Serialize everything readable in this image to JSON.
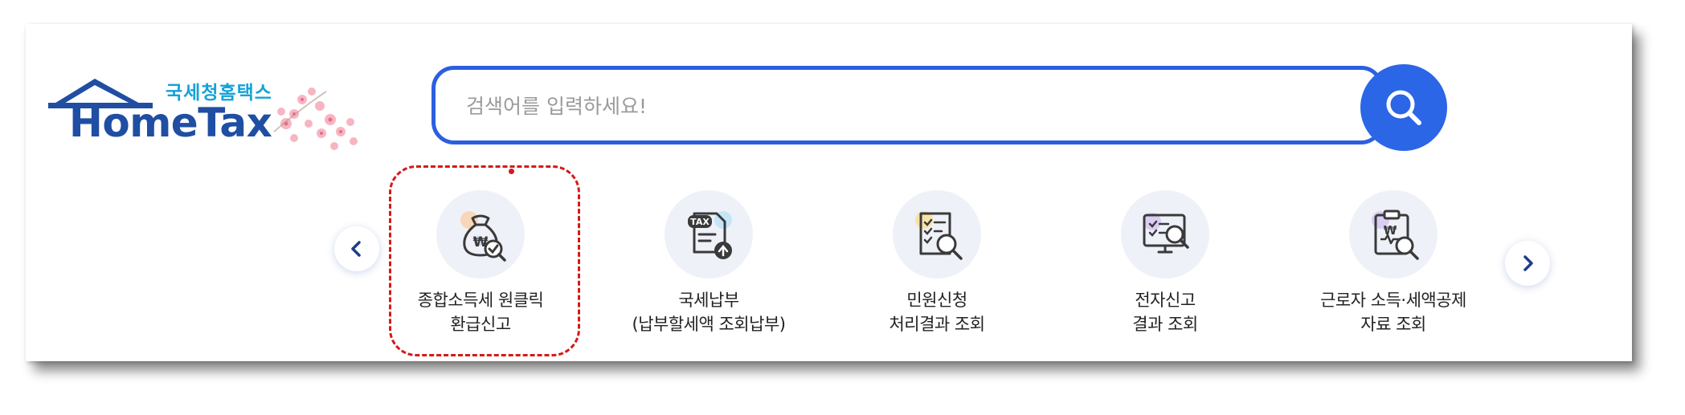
{
  "logo": {
    "subtitle": "국세청홈택스",
    "title": "HomeTax",
    "colors": {
      "title": "#1f4ea3",
      "subtitle": "#14a2d8"
    }
  },
  "search": {
    "placeholder": "검색어를 입력하세요!",
    "value": "",
    "accent_color": "#2c5fe0",
    "button_icon": "search-icon"
  },
  "carousel": {
    "prev_icon": "chevron-left-icon",
    "next_icon": "chevron-right-icon"
  },
  "quick_menu": [
    {
      "label": "종합소득세 원클릭\n환급신고",
      "icon": "money-bag-icon",
      "highlighted": true
    },
    {
      "label": "국세납부\n(납부할세액 조회납부)",
      "icon": "tax-document-upload-icon"
    },
    {
      "label": "민원신청\n처리결과 조회",
      "icon": "document-search-icon"
    },
    {
      "label": "전자신고\n결과 조회",
      "icon": "monitor-search-icon"
    },
    {
      "label": "근로자 소득·세액공제\n자료 조회",
      "icon": "clipboard-search-icon"
    }
  ],
  "highlight_color": "#d41a1a"
}
